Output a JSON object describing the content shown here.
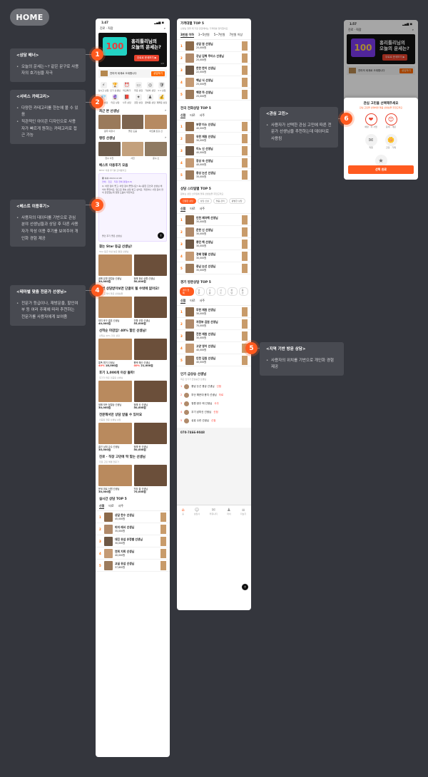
{
  "title": "HOME",
  "annotations": [
    {
      "num": "1",
      "title": "<상담 배너>",
      "lines": [
        "오늘의 운세는~? 같은 문구로 사용자의 호기심을 자극"
      ]
    },
    {
      "num": "2",
      "title": "<서비스 카테고리>",
      "lines": [
        "다양한 카테고리를 한눈에 볼 수 있음",
        "직관적인 아이콘 디자인으로 사용자가 빠르게 원하는 카테고리로 접근 가능"
      ]
    },
    {
      "num": "3",
      "title": "<베스트 이용후기>",
      "lines": [
        "사용자의 데이터를 기반으로 관심 분야 선생님들과 상담 후 다른 사용자가 작성 이용 후기를 보여주어 개인화 경험 제공"
      ]
    },
    {
      "num": "4",
      "title": "<테마별 맞춤 전문가 선생님>",
      "lines": [
        "전문가 등급이나, 재방문율, 할인여부 등 여러 주제에 따라 추천하는 전문가를 사용자에게 보여줌"
      ]
    },
    {
      "num": "5",
      "title": "<지역 기반 방문 상담>",
      "lines": [
        "사용자의 위치를 기반으로 개인화 경험 제공"
      ]
    },
    {
      "num": "6",
      "title": "<관심 고민>",
      "lines": [
        "사용자가 선택한 관심 고민에 따른 전문가 선생님을 추천하는데 데이터로 사용됨"
      ]
    }
  ],
  "phone1": {
    "time": "1:47",
    "location": "진로 · 직장",
    "banner": {
      "logo": "100",
      "headline1": "홍리틀리님의",
      "headline2": "오늘의 운세는?",
      "cta": "무료로 운세보기 ▶",
      "pager": "1/5"
    },
    "promo": {
      "text": "전미의 세계로 오대합니다",
      "button": "상담하기"
    },
    "categories": [
      {
        "icon": "⚡",
        "label": "실시간 상담"
      },
      {
        "icon": "🏆",
        "label": "인기 선생님"
      },
      {
        "icon": "⏰",
        "label": "마감특가"
      },
      {
        "icon": "▭",
        "label": "무료 상담"
      },
      {
        "icon": "◎",
        "label": "가성비 상담"
      },
      {
        "icon": "🛡",
        "label": "1:1 상담"
      },
      {
        "icon": "💎",
        "label": "신점 상담"
      },
      {
        "icon": "🔮",
        "label": "타로 상담"
      },
      {
        "icon": "📕",
        "label": "사주 상담"
      },
      {
        "icon": "✦",
        "label": "궁합 상담"
      },
      {
        "icon": "♟",
        "label": "꿈해몽 상담"
      },
      {
        "icon": "💰",
        "label": "재물운 상담"
      }
    ],
    "recent_title": "최근 본 선생님",
    "recent": [
      "원주 의정사",
      "올린 도움",
      "아트롱 토깅 신"
    ],
    "weekly_title": "랭킹 선생님",
    "weekly": [
      "한수 사진",
      "사진",
      "운수 소"
    ],
    "review_title": "베스트 이용후기 모음",
    "review_sub": "BEST 이용 후기를 모아봤어요",
    "review_user": "황 수수",
    "review_date": "2024.12.08",
    "review_tag": "연애 · 진로 · 직장 전체 평점(9.8)",
    "review_text": "Q. 어떤 점이 좋고, 어떤 점이 좋았나요? 속시원한 조언과 선생님 해석이 좋았어요. 앞으로 계속 상담 받고 싶어요. 직업이나 사업 운이 많이 궁금했는데 정말 도움이 되었어요.",
    "review_foot": "올인 후기 좋은 선생님",
    "star_title": "찾는 Star 등급 선생님!",
    "star_sub": "Star 등급 이상 높은 평점 선생님",
    "star_cards": [
      {
        "name": "꿈해 유명 영업상 선생님",
        "price": "30,000원"
      },
      {
        "name": "정해 위로 상향 선생님",
        "price": "50,000원"
      }
    ],
    "revisit_title": "한번 상담받아보면 단골이 될 수밖에 없어요!",
    "revisit_sub": "단골 고객이 많은 선생님들",
    "revisit_cards": [
      {
        "name": "대지 후구 결혼 선생님",
        "price": "40,000원"
      },
      {
        "name": "진행 신명 선생님",
        "price": "55,000원"
      }
    ],
    "sale_title": "선착순 마감임! 40% 할인 선생님!",
    "sale_sub": "선착순 40% 할인 상담",
    "sale_cards": [
      {
        "name": "통폭 원거 선생님",
        "pct": "40%",
        "price": "18,000원"
      },
      {
        "name": "평택 해산 선생님",
        "pct": "40%",
        "price": "21,000원"
      }
    ],
    "review1000_title": "후기 1,000개 이상 돌파!",
    "review1000_sub": "후기가 많은 인증된 선생님",
    "review1000_cards": [
      {
        "name": "정해 모든 정열상 선생님",
        "price": "30,000원"
      },
      {
        "name": "정해 신 선생님",
        "price": "50,000원"
      }
    ],
    "verified_title": "전문해서만 상담 받을 수 있어요",
    "verified_sub": "인증된 전문 선생님 상담",
    "verified_cards": [
      {
        "name": "홍인 상대 교수 선생님",
        "price": "30,000원"
      },
      {
        "name": "정해 현 선생님",
        "price": "50,000원"
      }
    ],
    "career_title": "진로 · 직장 고민에 딱 맞는 선생님",
    "career_sub": "진로 고민 해결 전문가",
    "career_cards": [
      {
        "name": "운세 위로 신원 선생님",
        "price": "30,000원"
      },
      {
        "name": "직장 결 선생님",
        "price": "70,000원"
      }
    ],
    "realtime_title": "실시간 상담 TOP 5",
    "realtime_tabs": [
      "신점",
      "타로",
      "사주"
    ],
    "realtime": [
      {
        "rank": "1",
        "name": "상담 한수 선생님",
        "price": "45,000원"
      },
      {
        "rank": "2",
        "name": "미미 레서 선생님",
        "price": "35,000원"
      },
      {
        "rank": "3",
        "name": "대진 유섭 유정별 선생님",
        "price": "30,000원"
      },
      {
        "rank": "4",
        "name": "연희 지희 선생님",
        "price": "40,000원"
      },
      {
        "rank": "5",
        "name": "교실 유섭 선생님",
        "price": "37,800원"
      }
    ]
  },
  "phone2": {
    "price_title": "가격대별 TOP 5",
    "price_sub": "선생님 찾을 때 가장 궁금해하는 가격대를 정리했어요",
    "price_tabs": [
      "3만원 이하",
      "3~5만원",
      "5~7만원",
      "7만원 이상"
    ],
    "price_list": [
      {
        "rank": "1",
        "name": "상담 원 선생님",
        "price": "25,000원"
      },
      {
        "rank": "2",
        "name": "강남 김해 주미스 선생님",
        "price": "25,000원"
      },
      {
        "rank": "3",
        "name": "한한 한이 선생님",
        "price": "22,000원"
      },
      {
        "rank": "4",
        "name": "해남 식 선생님",
        "price": "25,000원"
      },
      {
        "rank": "5",
        "name": "해명 하 선생님",
        "price": "25,000원"
      }
    ],
    "phone_title": "전국 전화상담 TOP 5",
    "phone_tabs": [
      "신점",
      "타로",
      "사주"
    ],
    "phone_list": [
      {
        "rank": "1",
        "name": "부량 미소 선생님",
        "price": "40,000원"
      },
      {
        "rank": "2",
        "name": "유한 재원 선생님",
        "price": "30,000원"
      },
      {
        "rank": "3",
        "name": "이노 신 선생님",
        "price": "40,000원"
      },
      {
        "rank": "4",
        "name": "장성 숙 선생님",
        "price": "40,000원"
      },
      {
        "rank": "5",
        "name": "중성 논선 선생님",
        "price": "35,000원"
      }
    ],
    "style_title": "상담 스타일별 TOP 5",
    "style_sub": "원하는 상담 스타일에 맞춰 선생님을 추천드려요",
    "style_chips": [
      "친절한 상담",
      "상담 신설",
      "맞춤 관리",
      "활발한 상담"
    ],
    "style_tabs": [
      "신점",
      "타로",
      "사주"
    ],
    "style_list": [
      {
        "rank": "1",
        "name": "인천 제자해 선생님",
        "price": "35,000원"
      },
      {
        "rank": "2",
        "name": "운한 신 선생님",
        "price": "30,000원"
      },
      {
        "rank": "3",
        "name": "종민 해 선생님",
        "price": "30,000원"
      },
      {
        "rank": "4",
        "name": "경혜 명률 선생님",
        "price": "30,000원"
      },
      {
        "rank": "5",
        "name": "중남 논선 선생님",
        "price": "35,000원"
      }
    ],
    "visit_title": "경기 방문상담 TOP 5",
    "visit_chips": [
      "경기 전체",
      "남양",
      "수원",
      "시흥",
      "성남",
      "용인"
    ],
    "visit_tabs": [
      "신점",
      "타로",
      "사주"
    ],
    "visit_list": [
      {
        "rank": "1",
        "name": "무한 재원 선생님",
        "price": "30,000원"
      },
      {
        "rank": "2",
        "name": "자정부 김원 선생님",
        "price": "70,000원"
      },
      {
        "rank": "3",
        "name": "진한 재원 선생님",
        "price": "30,000원"
      },
      {
        "rank": "4",
        "name": "고양 영어 선생님",
        "price": "40,000원"
      },
      {
        "rank": "5",
        "name": "인천 김원 선생님",
        "price": "40,000원"
      }
    ],
    "popular_title": "인기 급상승 선생님",
    "popular_sub": "최근 인기가 급상승한 선생님",
    "popular": [
      {
        "rank": "1",
        "name": "충남 논선 용궁 선생님",
        "tag": "신점"
      },
      {
        "rank": "2",
        "name": "부산 해운대 용지 선생님",
        "tag": "타로"
      },
      {
        "rank": "3",
        "name": "정원 광주 에 선생님",
        "tag": "사주"
      },
      {
        "rank": "4",
        "name": "우기 남미신 선생님",
        "tag": "신점"
      },
      {
        "rank": "5",
        "name": "상호 수란 선생님",
        "tag": "신점"
      }
    ],
    "phone_number": "070-7466-9048",
    "nav": [
      "홈",
      "상담사",
      "커뮤니티",
      "마이",
      "더보기"
    ]
  },
  "phone3": {
    "time": "1:57",
    "location": "진로 · 직장",
    "modal_title": "관심 고민을 선택해주세요",
    "modal_sub": "관심 고민을 선택하면 맞춤 선생님을 추천드려요",
    "interests": [
      {
        "icon": "❤",
        "label": "애정 · 타 사업",
        "badge": "연애·진로",
        "selected": true
      },
      {
        "icon": "😊",
        "label": "운세 · 개운",
        "badge": "사주",
        "selected": true
      },
      {
        "icon": "✉",
        "label": "직업",
        "badge": "",
        "selected": false
      },
      {
        "icon": "🌼",
        "label": "건강 · 가족",
        "badge": "",
        "selected": false
      },
      {
        "icon": "★",
        "label": "기타",
        "badge": "",
        "selected": false
      }
    ],
    "confirm": "선택 완료"
  },
  "colors": {
    "accent": "#ff5a1f",
    "background": "#34363d",
    "annotation_bg": "#484a51"
  }
}
